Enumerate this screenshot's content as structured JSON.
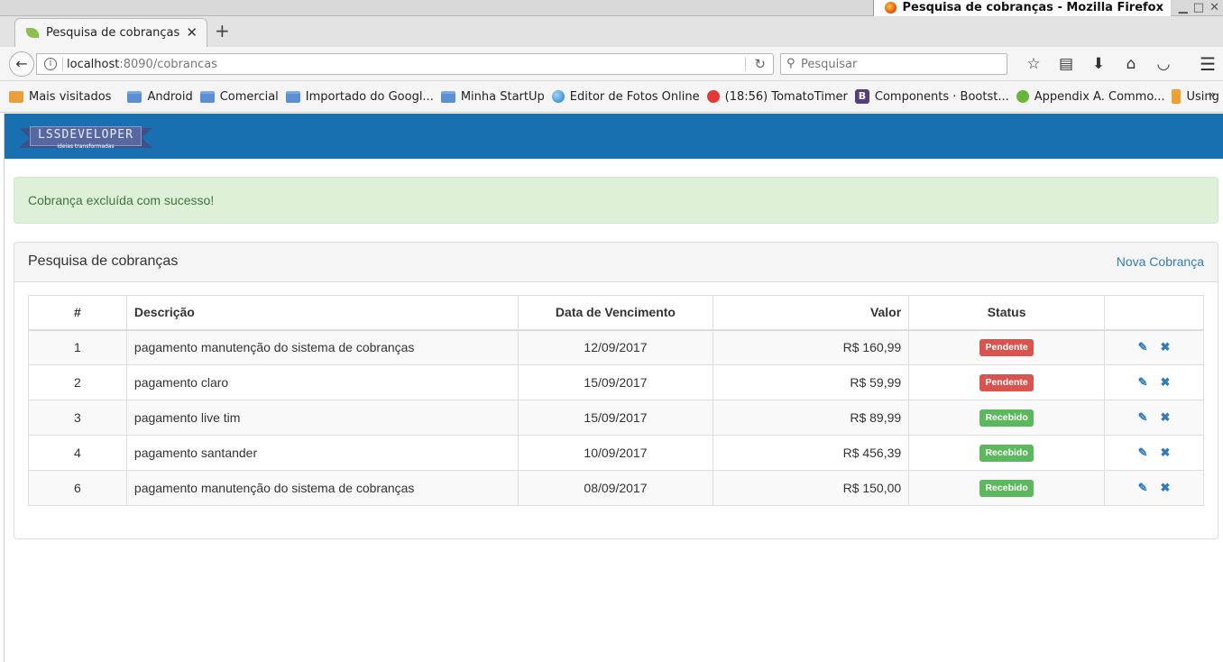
{
  "window": {
    "title": "Pesquisa de cobranças - Mozilla Firefox",
    "buttons": [
      "▁",
      "□",
      "✕"
    ]
  },
  "tab": {
    "label": "Pesquisa de cobranças",
    "close": "✕",
    "new_tab": "+"
  },
  "nav": {
    "url_host": "localhost",
    "url_path": ":8090/cobrancas",
    "search_placeholder": "Pesquisar"
  },
  "bookmarks": {
    "items": [
      {
        "label": "Mais visitados",
        "icon": "star-folder-icon"
      },
      {
        "label": "Android",
        "icon": "folder-icon"
      },
      {
        "label": "Comercial",
        "icon": "folder-icon"
      },
      {
        "label": "Importado do Googl...",
        "icon": "folder-icon"
      },
      {
        "label": "Minha StartUp",
        "icon": "folder-icon"
      },
      {
        "label": "Editor de Fotos Online",
        "icon": "globe-icon"
      },
      {
        "label": "(18:56) TomatoTimer",
        "icon": "tomato-icon"
      },
      {
        "label": "Components · Bootst...",
        "icon": "bootstrap-icon"
      },
      {
        "label": "Appendix A. Commo...",
        "icon": "spring-icon"
      },
      {
        "label": "Using GitFlow With G...",
        "icon": "git-icon"
      }
    ],
    "overflow": "»"
  },
  "site": {
    "logo_text": "LSSDEVELOPER",
    "logo_sub": "ideias transformadas",
    "alert": "Cobrança excluída com sucesso!"
  },
  "panel": {
    "title": "Pesquisa de cobranças",
    "new_link": "Nova Cobrança"
  },
  "table": {
    "headers": [
      "#",
      "Descrição",
      "Data de Vencimento",
      "Valor",
      "Status",
      ""
    ],
    "rows": [
      {
        "id": "1",
        "descricao": "pagamento manutenção do sistema de cobranças",
        "data": "12/09/2017",
        "valor": "R$ 160,99",
        "status": "Pendente"
      },
      {
        "id": "2",
        "descricao": "pagamento claro",
        "data": "15/09/2017",
        "valor": "R$ 59,99",
        "status": "Pendente"
      },
      {
        "id": "3",
        "descricao": "pagamento live tim",
        "data": "15/09/2017",
        "valor": "R$ 89,99",
        "status": "Recebido"
      },
      {
        "id": "4",
        "descricao": "pagamento santander",
        "data": "10/09/2017",
        "valor": "R$ 456,39",
        "status": "Recebido"
      },
      {
        "id": "6",
        "descricao": "pagamento manutenção do sistema de cobranças",
        "data": "08/09/2017",
        "valor": "R$ 150,00",
        "status": "Recebido"
      }
    ]
  },
  "colors": {
    "header": "#1870b0",
    "pendente": "#d9534f",
    "recebido": "#5cb85c",
    "link": "#337ab7"
  }
}
